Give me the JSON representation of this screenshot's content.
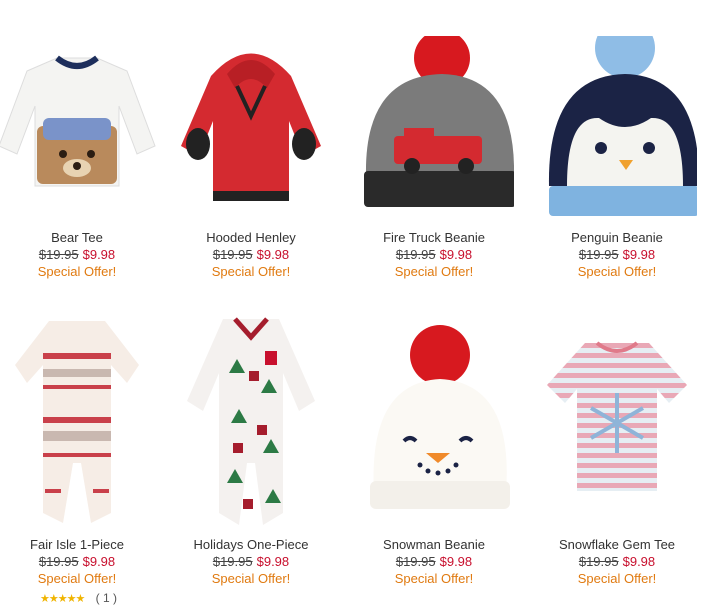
{
  "products": [
    {
      "name": "Bear Tee",
      "old_price": "$19.95",
      "sale_price": "$9.98",
      "offer": "Special Offer!"
    },
    {
      "name": "Hooded Henley",
      "old_price": "$19.95",
      "sale_price": "$9.98",
      "offer": "Special Offer!"
    },
    {
      "name": "Fire Truck Beanie",
      "old_price": "$19.95",
      "sale_price": "$9.98",
      "offer": "Special Offer!"
    },
    {
      "name": "Penguin Beanie",
      "old_price": "$19.95",
      "sale_price": "$9.98",
      "offer": "Special Offer!"
    },
    {
      "name": "Fair Isle 1-Piece",
      "old_price": "$19.95",
      "sale_price": "$9.98",
      "offer": "Special Offer!"
    },
    {
      "name": "Holidays One-Piece",
      "old_price": "$19.95",
      "sale_price": "$9.98",
      "offer": "Special Offer!"
    },
    {
      "name": "Snowman Beanie",
      "old_price": "$19.95",
      "sale_price": "$9.98",
      "offer": "Special Offer!"
    },
    {
      "name": "Snowflake Gem Tee",
      "old_price": "$19.95",
      "sale_price": "$9.98",
      "offer": "Special Offer!"
    }
  ],
  "rating": {
    "stars": "★★★★★",
    "count": "( 1 )"
  },
  "colors": {
    "sale": "#c8102e",
    "offer": "#e07a10",
    "star": "#f0b400"
  }
}
